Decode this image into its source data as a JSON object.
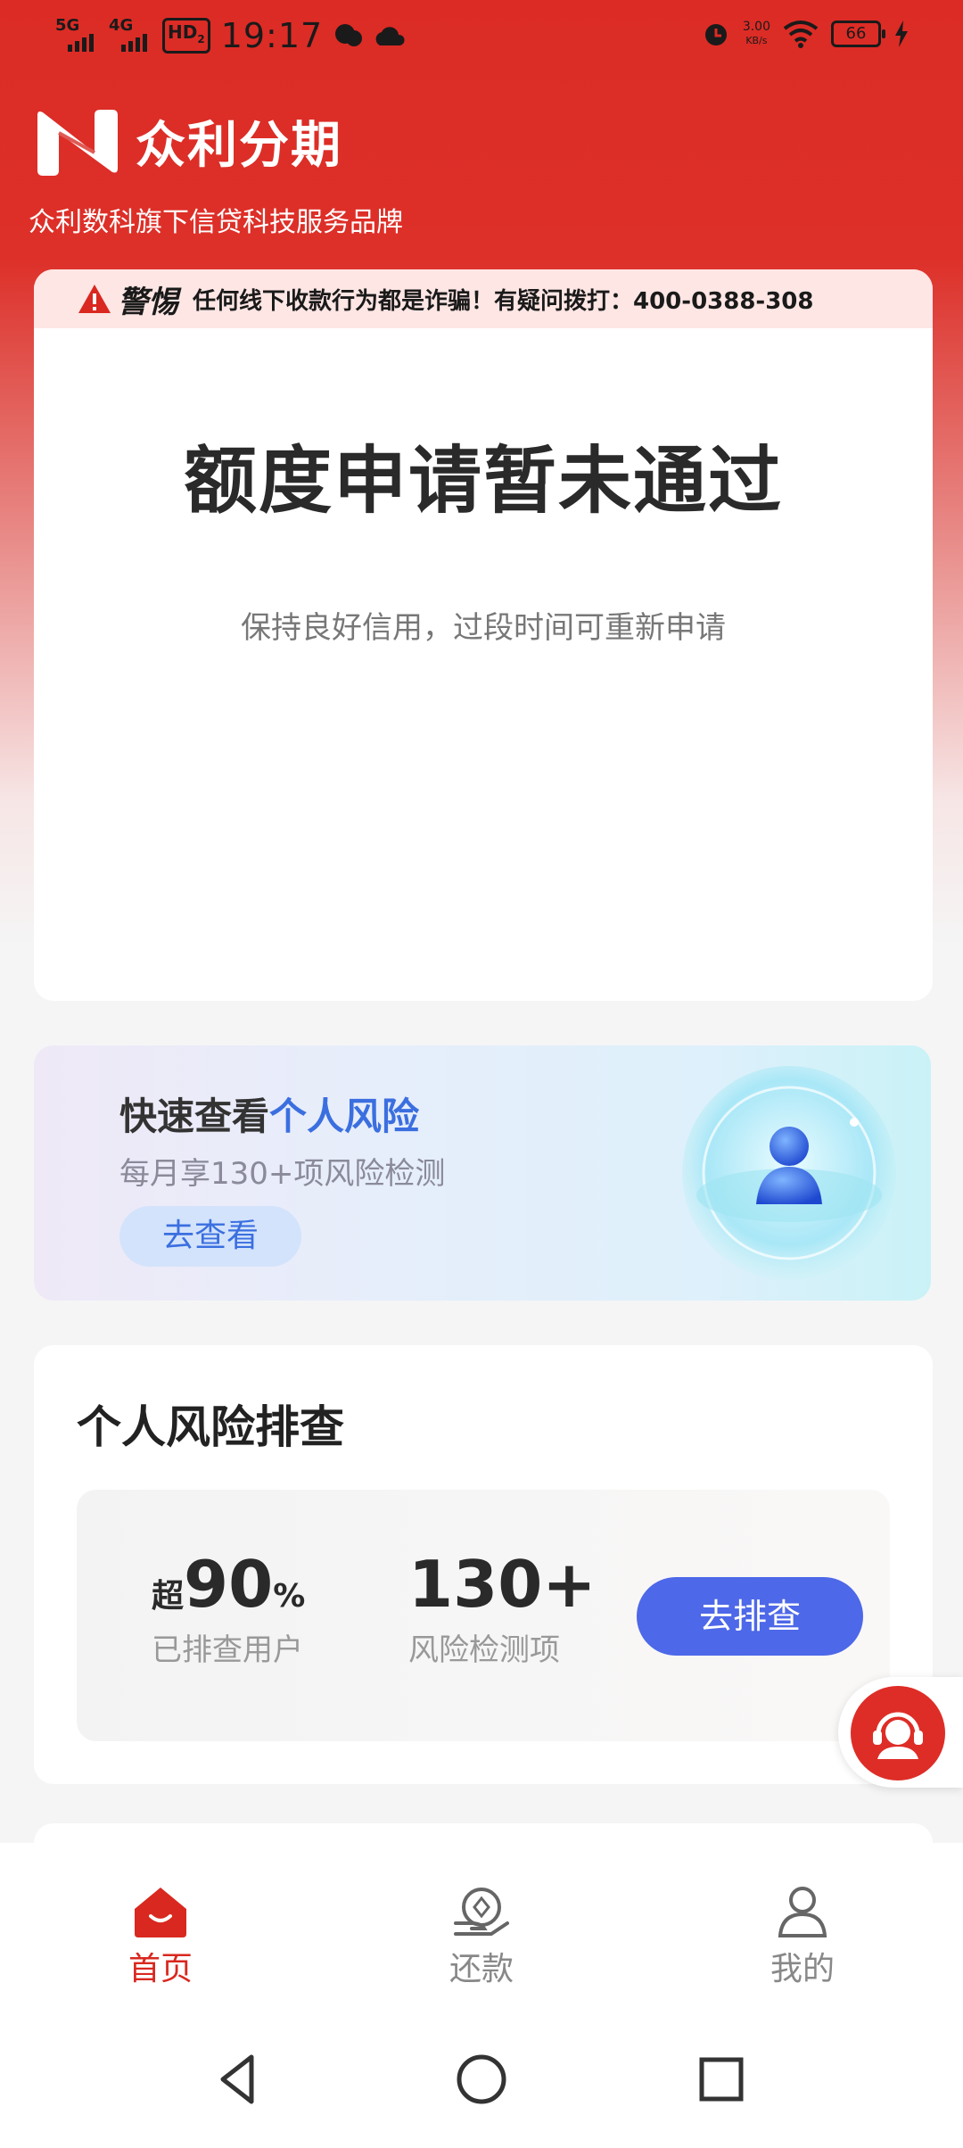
{
  "status_bar": {
    "signal1": "5G",
    "signal2": "4G",
    "hd_badge": "HD",
    "hd_sub": "2",
    "time": "19:17",
    "net_speed_value": "3.00",
    "net_speed_unit": "KB/s",
    "battery_level": "66"
  },
  "header": {
    "brand_name": "众利分期",
    "slogan": "众利数科旗下信贷科技服务品牌"
  },
  "warning": {
    "title": "警惕",
    "text": "任何线下收款行为都是诈骗！有疑问拨打：400-0388-308"
  },
  "status_card": {
    "title": "额度申请暂未通过",
    "subtitle": "保持良好信用，过段时间可重新申请"
  },
  "risk_banner": {
    "title_plain": "快速查看",
    "title_highlight": "个人风险",
    "subtitle": "每月享130+项风险检测",
    "button_label": "去查看"
  },
  "risk_check": {
    "title": "个人风险排查",
    "stat1_prefix": "超",
    "stat1_value": "90",
    "stat1_suffix": "%",
    "stat1_label": "已排查用户",
    "stat2_value": "130+",
    "stat2_label": "风险检测项",
    "button_label": "去排查"
  },
  "tabbar": {
    "home": "首页",
    "repay": "还款",
    "mine": "我的",
    "active": "home"
  },
  "colors": {
    "brand_red": "#dc2b25",
    "accent_blue": "#4d68e8",
    "highlight_blue": "#3b6fe0"
  },
  "icons": [
    "warning-icon",
    "customer-service-icon",
    "home-icon",
    "repay-icon",
    "user-icon",
    "back-icon",
    "home-circle-icon",
    "recents-icon"
  ]
}
